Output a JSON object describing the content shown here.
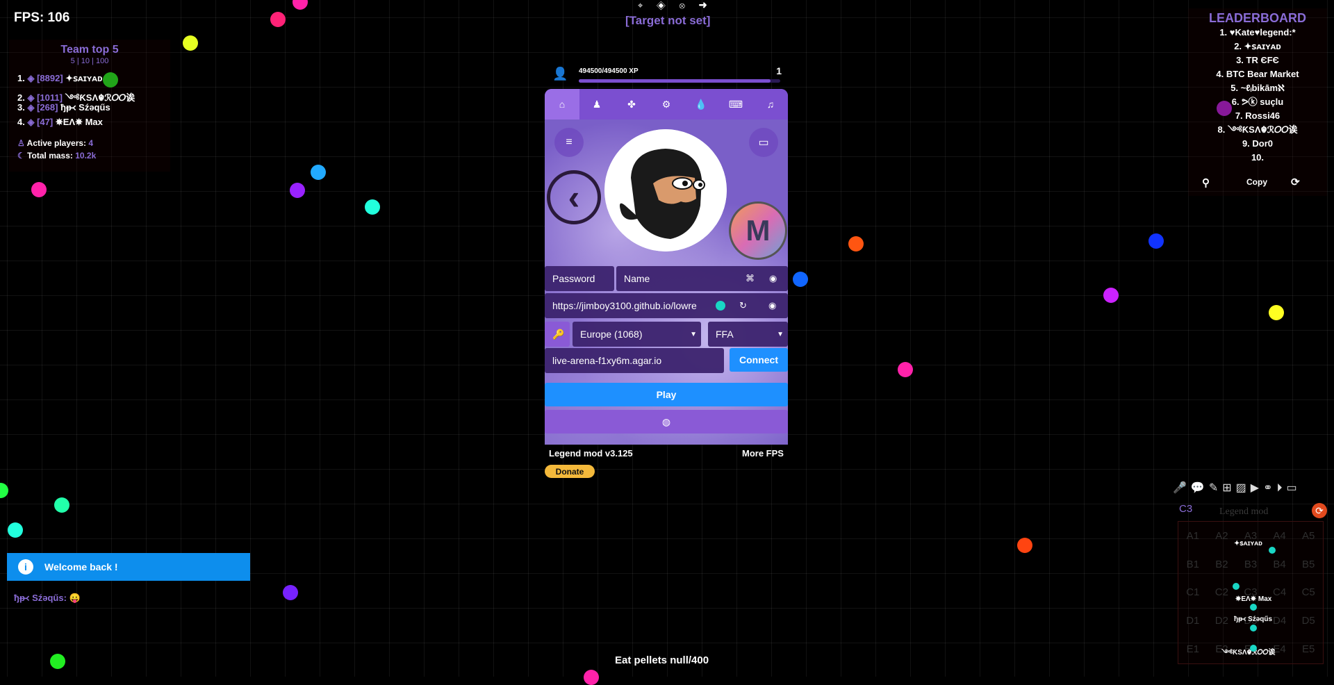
{
  "hud": {
    "fps": "FPS: 106",
    "target_icons": "⌖ ◈ ⊗ ➜",
    "target": "[Target not set]",
    "quest": "Eat pellets null/400"
  },
  "team": {
    "title": "Team top 5",
    "subtitle": "5 | 10 | 100",
    "rows": [
      {
        "rank": "1.",
        "mass": "[8892]",
        "name": "✦ꜱᴀɪʏᴀᴅ"
      },
      {
        "rank": "2.",
        "mass": "[1011]",
        "name": "༺ƘSΛ☬ℛ𝑂𝑂诶"
      },
      {
        "rank": "3.",
        "mass": "[268]",
        "name": "ђᵽ᚜ Sźəqűs"
      },
      {
        "rank": "4.",
        "mass": "[47]",
        "name": "✵EΛ✵ Max"
      }
    ],
    "active_label": "Active players:",
    "active_value": "4",
    "mass_label": "Total mass:",
    "mass_value": "10.2k"
  },
  "leaderboard": {
    "title": "LEADERBOARD",
    "items": [
      "1. ♥Kate♥legend:*",
      "2. ✦ꜱᴀɪʏᴀᴅ",
      "3. TR ЄFЄ",
      "4. BTC Bear Market",
      "5. ~ℓᵢbikāmℵ",
      "6. ᕗⓚ suçlu",
      "7. Rossi46",
      "8. ༺ƘSΛ☬ℛ𝑂𝑂诶",
      "9. Dor0",
      "10."
    ],
    "copy_label": "Copy"
  },
  "profile": {
    "xp_text": "494500/494500 XP",
    "level": "1",
    "xp_fraction": 0.95
  },
  "panel": {
    "tabs": [
      "home-icon",
      "user-icon",
      "puzzle-icon",
      "gear-icon",
      "drop-icon",
      "keyboard-icon",
      "music-icon"
    ],
    "password_label": "Password",
    "name_label": "Name",
    "skin_url": "https://jimboy3100.github.io/lowre",
    "region": "Europe (1068)",
    "mode": "FFA",
    "server": "live-arena-f1xy6m.agar.io",
    "connect_label": "Connect",
    "play_label": "Play"
  },
  "footer": {
    "version": "Legend mod v3.125",
    "more_fps": "More FPS",
    "donate": "Donate"
  },
  "notification": {
    "welcome": "Welcome back !",
    "chat_name": "ђᵽ᚜ Sźəqűs:",
    "chat_emoji": "😛"
  },
  "minimap": {
    "sector": "C3",
    "title": "Legend mod",
    "cells": [
      "A1",
      "A2",
      "A3",
      "A4",
      "A5",
      "B1",
      "B2",
      "B3",
      "B4",
      "B5",
      "C1",
      "C2",
      "C3",
      "C4",
      "C5",
      "D1",
      "D2",
      "D3",
      "D4",
      "D5",
      "E1",
      "E2",
      "E3",
      "E4",
      "E5"
    ],
    "players": [
      "✦ꜱᴀɪʏᴀᴅ",
      "✵EΛ✵ Max",
      "ђᵽ᚜ Sźəqűs",
      "༺ƘSΛ☬ℛ𝑂𝑂诶"
    ]
  },
  "colors": {
    "accent": "#8a6cd6",
    "panel_tab": "#7b4fd0",
    "button_blue": "#1e90ff",
    "donate": "#f4b93b"
  }
}
